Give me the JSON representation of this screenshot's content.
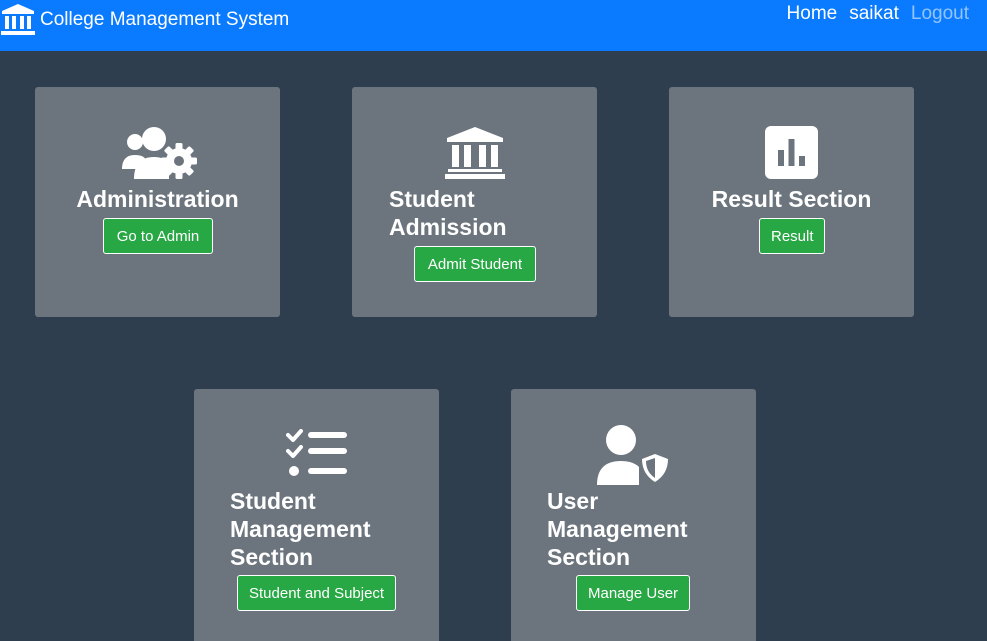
{
  "navbar": {
    "brand_title": "College Management System",
    "brand_icon": "institution-icon",
    "links": {
      "home": "Home",
      "user": "saikat",
      "logout": "Logout"
    }
  },
  "cards": {
    "administration": {
      "icon": "users-cog-icon",
      "title": "Administration",
      "button": "Go to Admin"
    },
    "student_admission": {
      "icon": "university-building-icon",
      "title_lines": [
        "Student",
        "Admission"
      ],
      "button": "Admit Student"
    },
    "result_section": {
      "icon": "bar-chart-icon",
      "title": "Result Section",
      "button": "Result"
    },
    "student_management": {
      "icon": "task-list-icon",
      "title_lines": [
        "Student",
        "Management",
        "Section"
      ],
      "button": "Student and Subject"
    },
    "user_management": {
      "icon": "user-shield-icon",
      "title_lines": [
        "User",
        "Management",
        "Section"
      ],
      "button": "Manage User"
    }
  },
  "colors": {
    "navbar": "#0a7bff",
    "page_background": "#2f3e4f",
    "card": "#6c757d",
    "button": "#28a745"
  }
}
